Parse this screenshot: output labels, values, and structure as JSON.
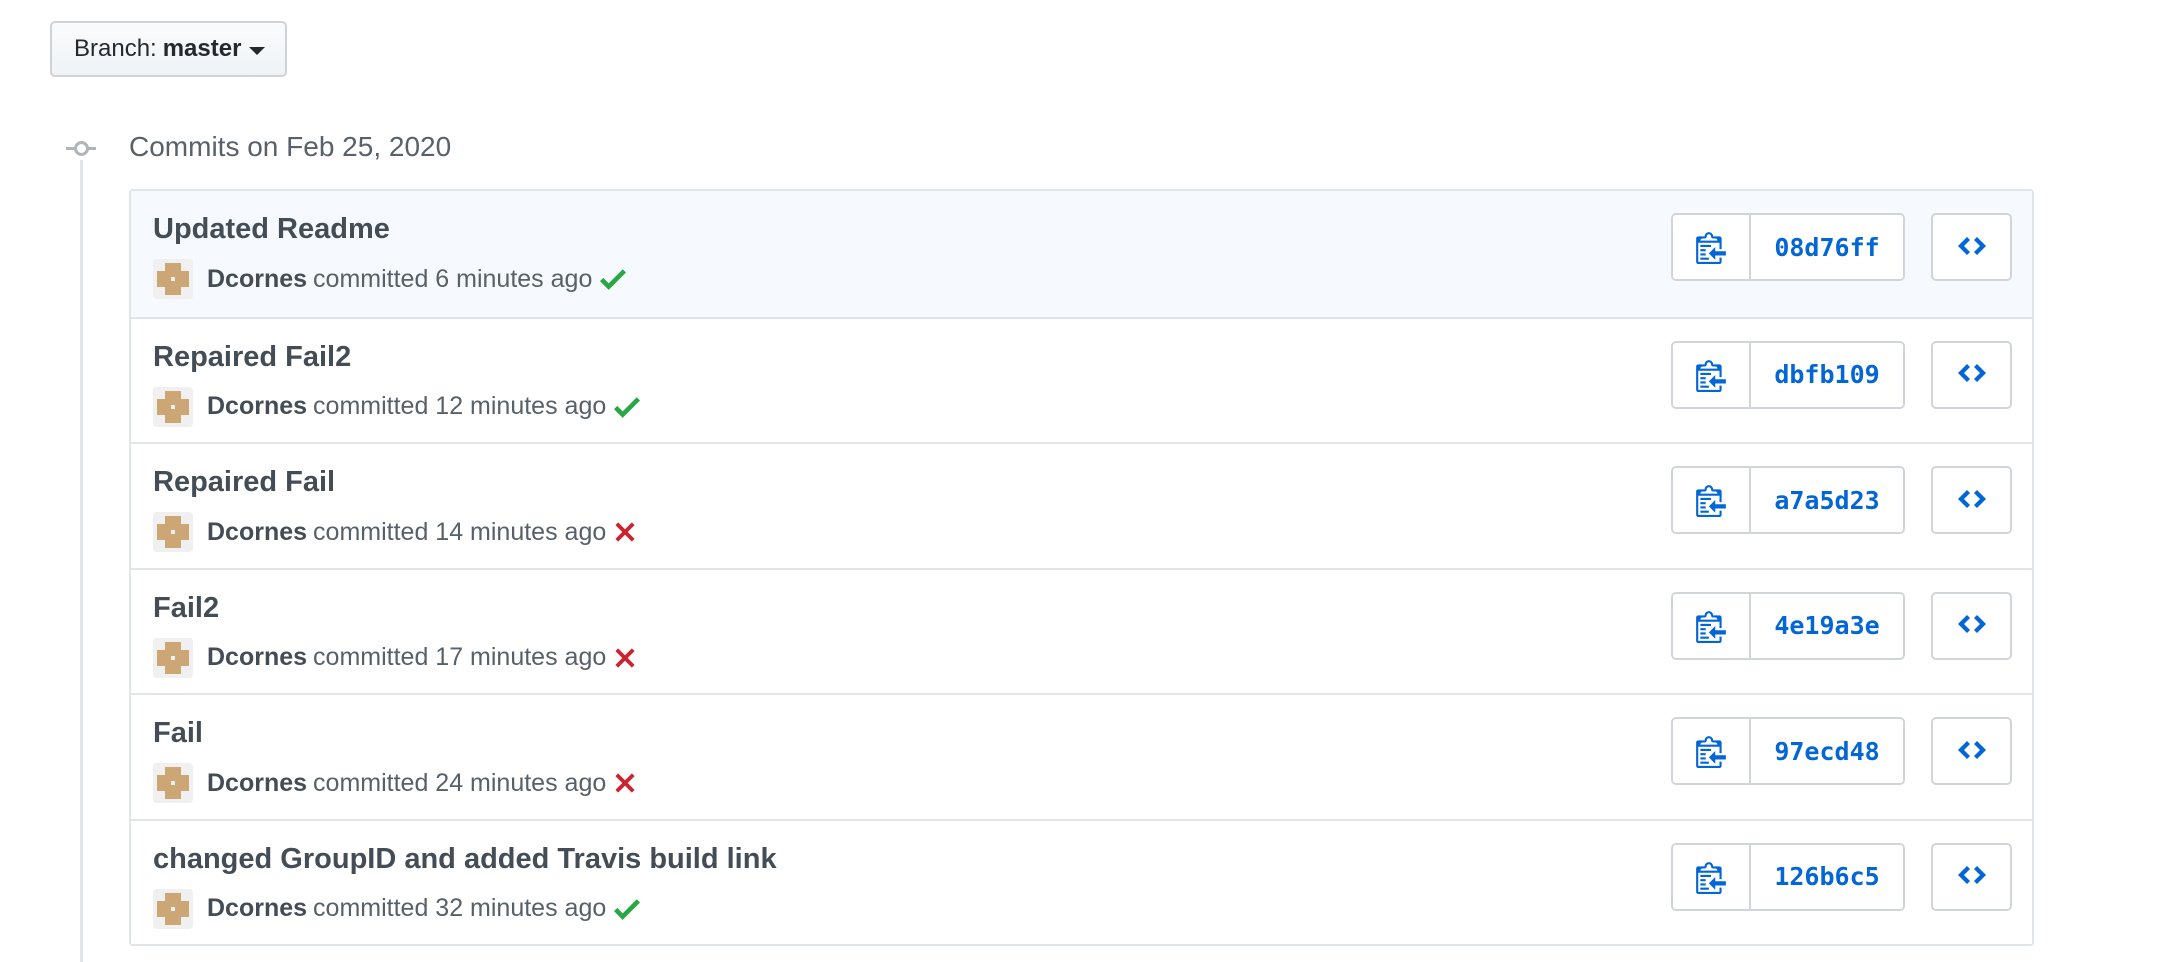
{
  "branch": {
    "label": "Branch:",
    "value": "master"
  },
  "commit_group": {
    "title": "Commits on Feb 25, 2020"
  },
  "commits": [
    {
      "title": "Updated Readme",
      "author": "Dcornes",
      "time": "committed 6 minutes ago",
      "status": "success",
      "sha": "08d76ff"
    },
    {
      "title": "Repaired Fail2",
      "author": "Dcornes",
      "time": "committed 12 minutes ago",
      "status": "success",
      "sha": "dbfb109"
    },
    {
      "title": "Repaired Fail",
      "author": "Dcornes",
      "time": "committed 14 minutes ago",
      "status": "failure",
      "sha": "a7a5d23"
    },
    {
      "title": "Fail2",
      "author": "Dcornes",
      "time": "committed 17 minutes ago",
      "status": "failure",
      "sha": "4e19a3e"
    },
    {
      "title": "Fail",
      "author": "Dcornes",
      "time": "committed 24 minutes ago",
      "status": "failure",
      "sha": "97ecd48"
    },
    {
      "title": "changed GroupID and added Travis build link",
      "author": "Dcornes",
      "time": "committed 32 minutes ago",
      "status": "success",
      "sha": "126b6c5"
    }
  ],
  "icons": {
    "copy": "clipboard-icon",
    "browse": "code-icon",
    "success": "check-icon",
    "failure": "x-icon",
    "timeline": "git-commit-icon"
  },
  "colors": {
    "link": "#0366d6",
    "success": "#28a745",
    "failure": "#cb2431",
    "highlight_row": "#f6fafe"
  }
}
